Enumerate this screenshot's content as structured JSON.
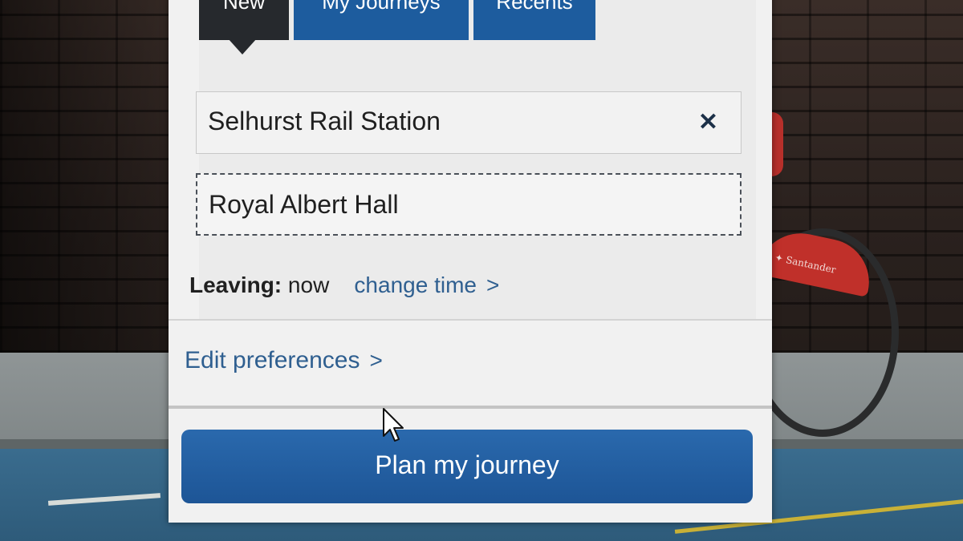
{
  "tabs": [
    {
      "label": "New",
      "active": true
    },
    {
      "label": "My Journeys",
      "active": false
    },
    {
      "label": "Recents",
      "active": false
    }
  ],
  "journey": {
    "from_value": "Selhurst Rail Station",
    "clear_icon": "close-icon",
    "to_value": "Royal Albert Hall"
  },
  "leaving": {
    "label": "Leaving:",
    "value": "now",
    "change_link": "change time"
  },
  "preferences": {
    "link": "Edit preferences"
  },
  "plan_button": {
    "label": "Plan my journey"
  },
  "colors": {
    "brand_blue": "#1d5c9e",
    "active_tab": "#26292d",
    "link": "#2f5f90"
  }
}
